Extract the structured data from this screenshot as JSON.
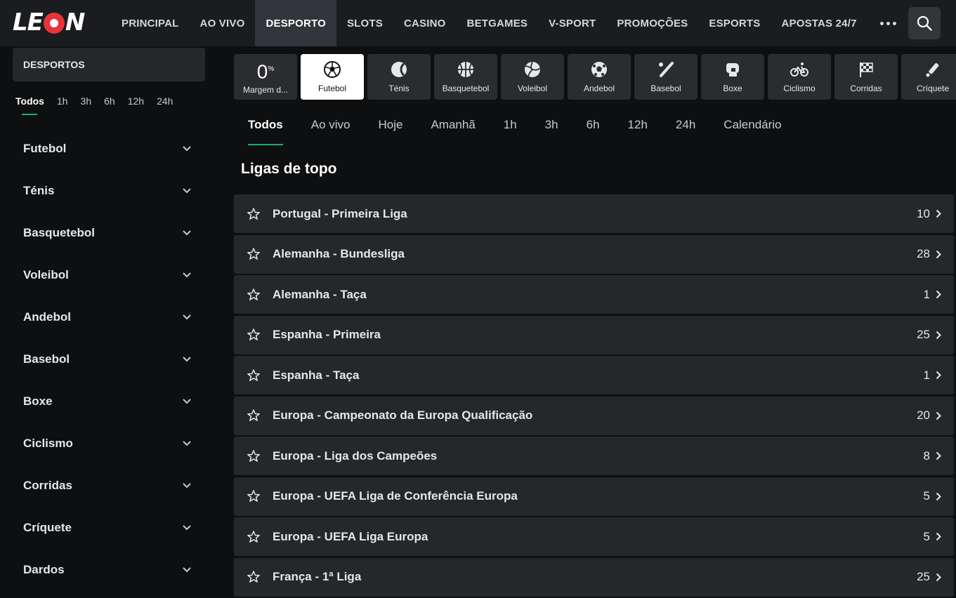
{
  "brand": {
    "logo_text_1": "LE",
    "logo_text_2": "N"
  },
  "nav": {
    "items": [
      "PRINCIPAL",
      "AO VIVO",
      "DESPORTO",
      "SLOTS",
      "CASINO",
      "BETGAMES",
      "V-SPORT",
      "PROMOÇÕES",
      "ESPORTS",
      "APOSTAS 24/7"
    ],
    "active": "DESPORTO"
  },
  "sidebar": {
    "header": "DESPORTOS",
    "filters": [
      "Todos",
      "1h",
      "3h",
      "6h",
      "12h",
      "24h"
    ],
    "sports": [
      "Futebol",
      "Ténis",
      "Basquetebol",
      "Voleibol",
      "Andebol",
      "Basebol",
      "Boxe",
      "Ciclismo",
      "Corridas",
      "Críquete",
      "Dardos"
    ]
  },
  "sport_row": {
    "margin": {
      "value": "0",
      "unit": "%",
      "label": "Margem d..."
    },
    "tiles": [
      {
        "label": "Futebol",
        "icon": "soccer-ball-icon"
      },
      {
        "label": "Ténis",
        "icon": "tennis-ball-icon"
      },
      {
        "label": "Basquetebol",
        "icon": "basketball-icon"
      },
      {
        "label": "Voleibol",
        "icon": "volleyball-icon"
      },
      {
        "label": "Andebol",
        "icon": "handball-icon"
      },
      {
        "label": "Basebol",
        "icon": "baseball-bat-icon"
      },
      {
        "label": "Boxe",
        "icon": "boxing-glove-icon"
      },
      {
        "label": "Ciclismo",
        "icon": "bicycle-icon"
      },
      {
        "label": "Corridas",
        "icon": "checkered-flag-icon"
      },
      {
        "label": "Críquete",
        "icon": "cricket-bat-icon"
      }
    ]
  },
  "time_tabs": [
    "Todos",
    "Ao vivo",
    "Hoje",
    "Amanhã",
    "1h",
    "3h",
    "6h",
    "12h",
    "24h",
    "Calendário"
  ],
  "section_title": "Ligas de topo",
  "leagues": [
    {
      "name": "Portugal - Primeira Liga",
      "count": "10"
    },
    {
      "name": "Alemanha - Bundesliga",
      "count": "28"
    },
    {
      "name": "Alemanha - Taça",
      "count": "1"
    },
    {
      "name": "Espanha - Primeira",
      "count": "25"
    },
    {
      "name": "Espanha - Taça",
      "count": "1"
    },
    {
      "name": "Europa - Campeonato da Europa Qualificação",
      "count": "20"
    },
    {
      "name": "Europa - Liga dos Campeões",
      "count": "8"
    },
    {
      "name": "Europa - UEFA Liga de Conferência Europa",
      "count": "5"
    },
    {
      "name": "Europa - UEFA Liga Europa",
      "count": "5"
    },
    {
      "name": "França - 1ª Liga",
      "count": "25"
    }
  ],
  "colors": {
    "accent": "#0fb56d",
    "brand_red": "#e8333d",
    "panel": "#25272b"
  }
}
